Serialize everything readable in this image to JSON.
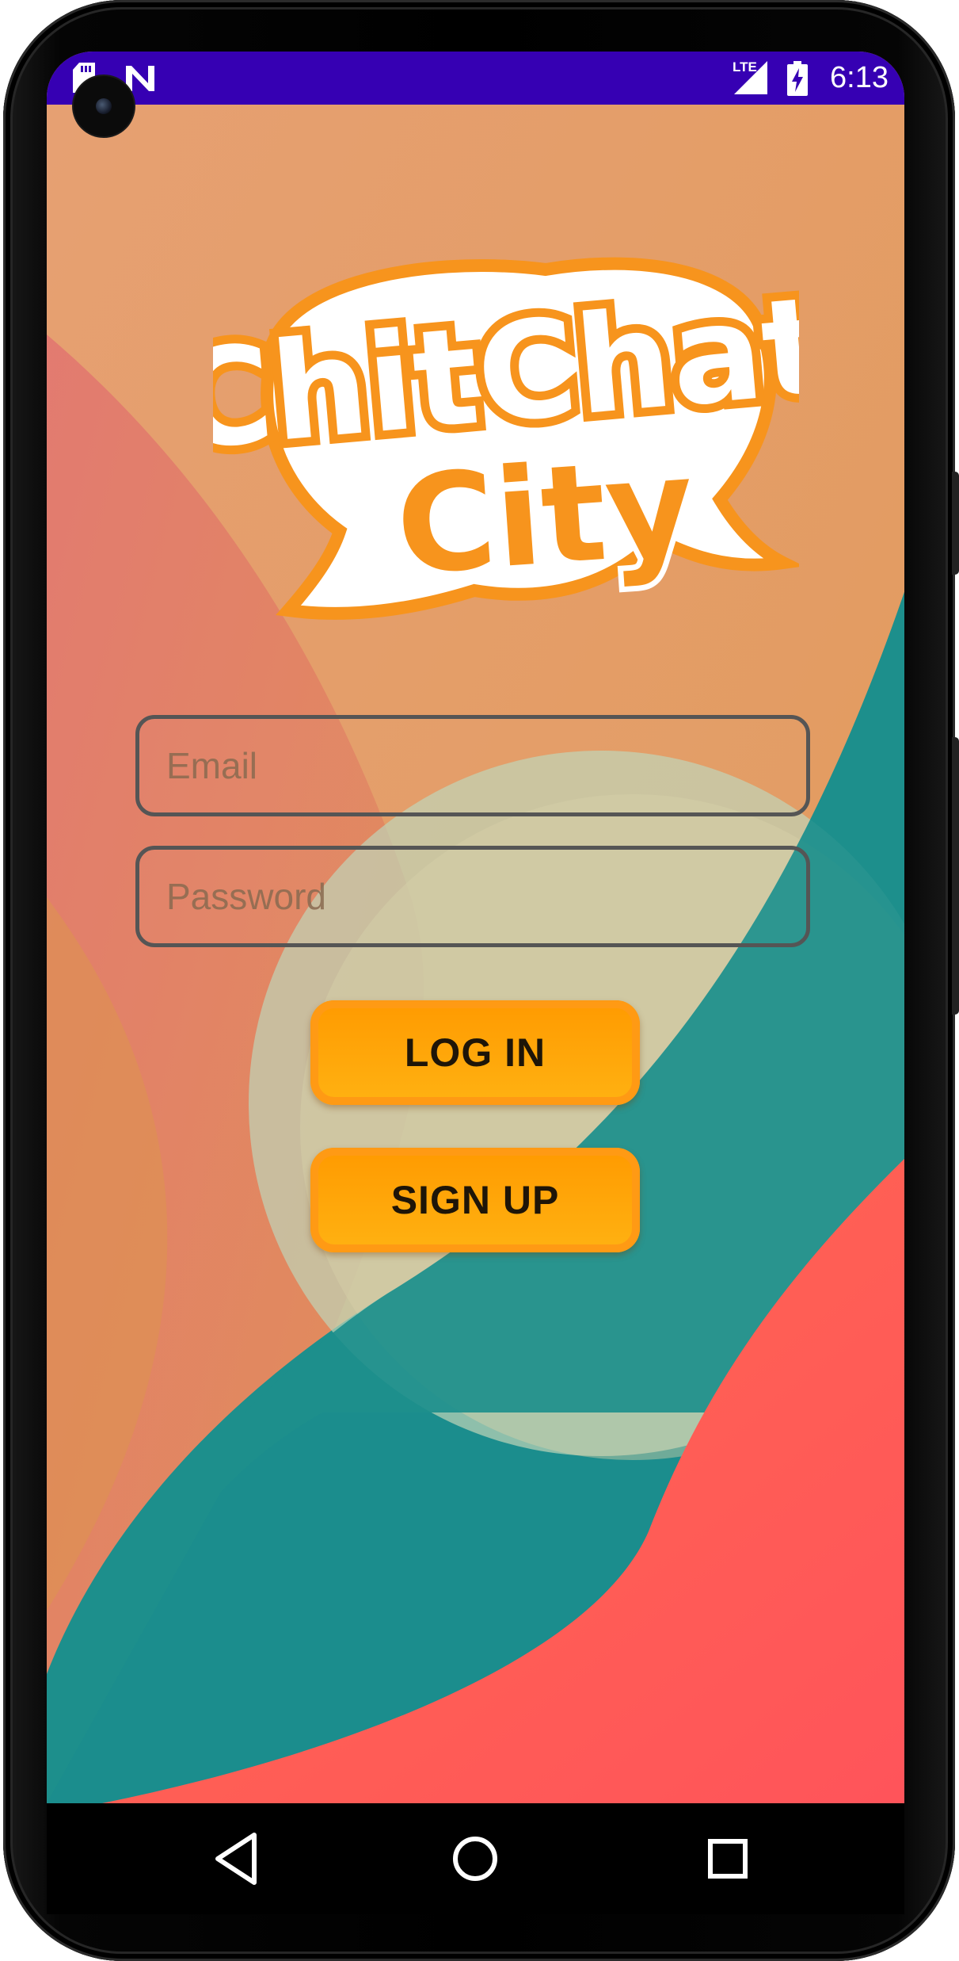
{
  "status_bar": {
    "time": "6:13",
    "network": "LTE",
    "icons": [
      "sd-card-icon",
      "n-notification-icon",
      "lte-signal-icon",
      "battery-charging-icon"
    ]
  },
  "app": {
    "logo_line1": "ChitChat",
    "logo_line2": "City"
  },
  "login_form": {
    "email_placeholder": "Email",
    "password_placeholder": "Password",
    "login_label": "LOG IN",
    "signup_label": "SIGN UP"
  },
  "navigation": {
    "items": [
      "back-icon",
      "home-icon",
      "recents-icon"
    ]
  },
  "colors": {
    "status_bar": "#3600b3",
    "background_peach": "#e6a070",
    "background_teal": "#1d8f8c",
    "background_coral": "#ff5a56",
    "button_orange": "#ffa20a",
    "logo_orange": "#f7941d"
  }
}
